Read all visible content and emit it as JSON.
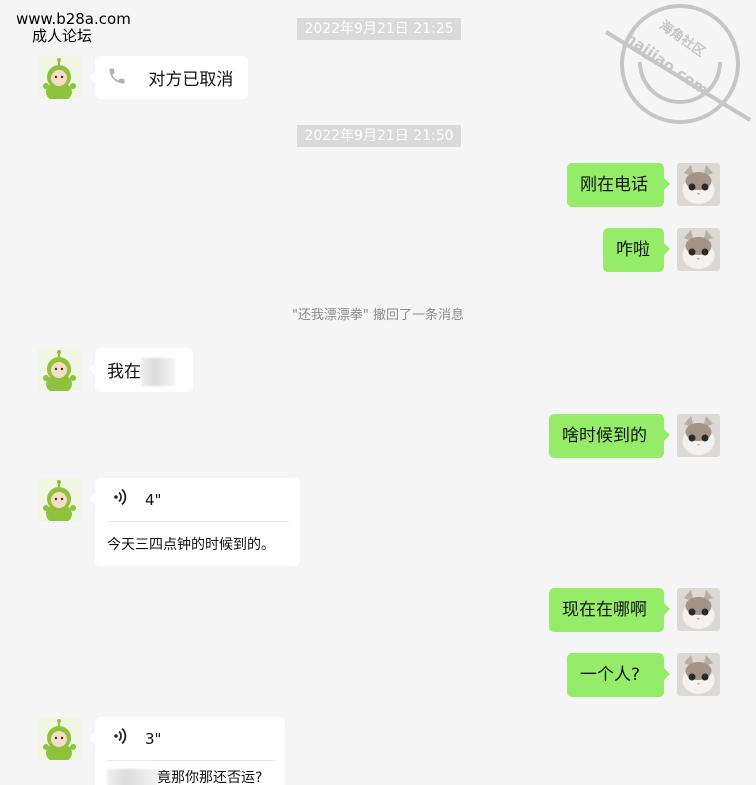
{
  "site": {
    "url": "www.b28a.com",
    "name": "成人论坛"
  },
  "watermark": {
    "top_text": "海角社区",
    "bottom_text": "haijiao.com",
    "color": "#c6c6c6"
  },
  "colors": {
    "background": "#f5f5f5",
    "sent_bubble": "#95ec69",
    "received_bubble": "#ffffff",
    "timestamp_bg": "#dadada"
  },
  "timestamps": [
    "2022年9月21日 21:25",
    "2022年9月21日 21:50"
  ],
  "messages": [
    {
      "side": "left",
      "type": "call",
      "icon": "phone-icon",
      "text": "对方已取消"
    },
    {
      "side": "right",
      "type": "text",
      "text": "刚在电话"
    },
    {
      "side": "right",
      "type": "text",
      "text": "咋啦"
    },
    {
      "side": "left",
      "type": "text",
      "text": "我在"
    },
    {
      "side": "right",
      "type": "text",
      "text": "啥时候到的"
    },
    {
      "side": "left",
      "type": "voice",
      "icon": "voice-icon",
      "duration": "4\"",
      "transcript": "今天三四点钟的时候到的。"
    },
    {
      "side": "right",
      "type": "text",
      "text": "现在在哪啊"
    },
    {
      "side": "right",
      "type": "text",
      "text": "一个人?"
    },
    {
      "side": "left",
      "type": "voice",
      "icon": "voice-icon",
      "duration": "3\"",
      "transcript": "竟那你那还否运?"
    }
  ],
  "system_notice": "\"还我漂漂拳\" 撤回了一条消息"
}
